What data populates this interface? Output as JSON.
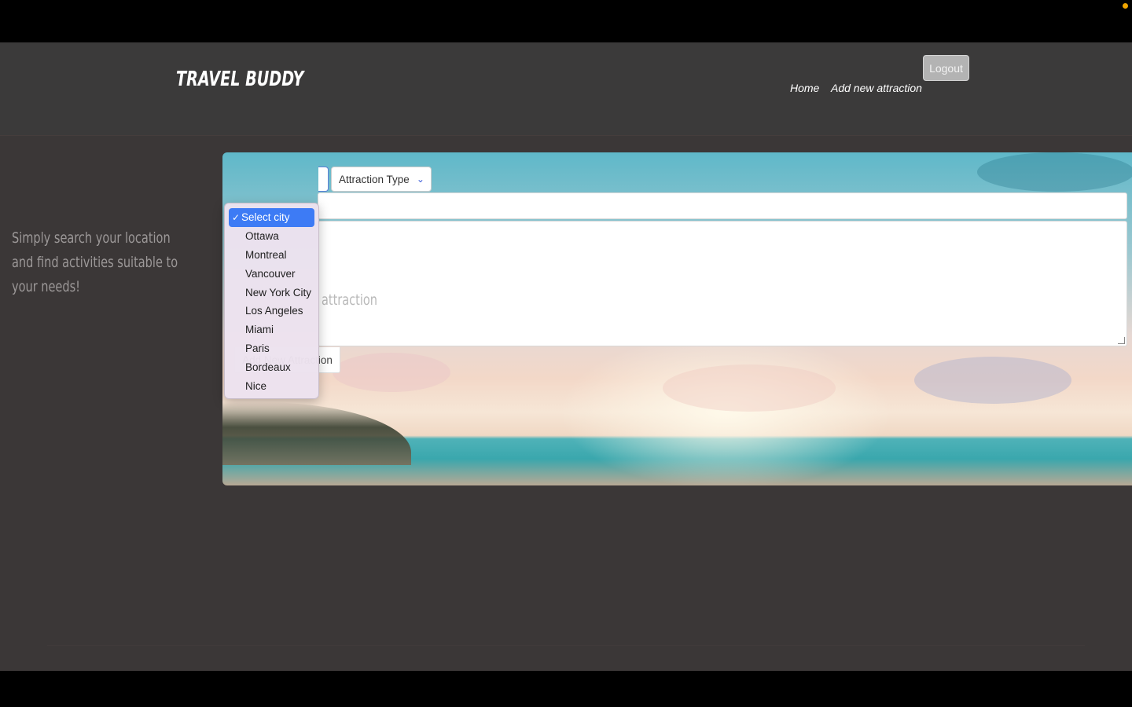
{
  "header": {
    "logo": "TRAVEL BUDDY",
    "nav": [
      {
        "label": "Home"
      },
      {
        "label": "Add new attraction"
      }
    ],
    "logout_label": "Logout"
  },
  "sidebar": {
    "tagline": "Simply search your location and find activities suitable to your needs!"
  },
  "form": {
    "city_select": {
      "selected": "Select city",
      "options": [
        "Select city",
        "Ottawa",
        "Montreal",
        "Vancouver",
        "New York City",
        "Los Angeles",
        "Miami",
        "Paris",
        "Bordeaux",
        "Nice"
      ]
    },
    "type_select": {
      "label": "Attraction Type"
    },
    "name_value": "",
    "description_placeholder_visible": "attraction",
    "submit_label": "Add New Attraction"
  },
  "icons": {
    "check": "check-icon",
    "chevron": "chevron-down-icon"
  }
}
